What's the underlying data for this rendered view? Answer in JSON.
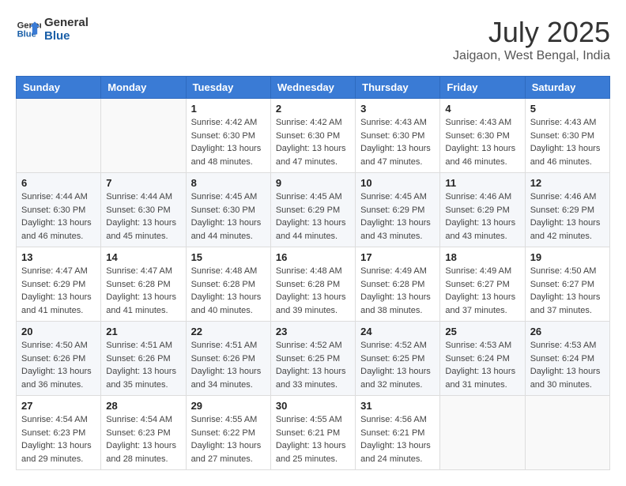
{
  "header": {
    "logo_line1": "General",
    "logo_line2": "Blue",
    "month": "July 2025",
    "location": "Jaigaon, West Bengal, India"
  },
  "weekdays": [
    "Sunday",
    "Monday",
    "Tuesday",
    "Wednesday",
    "Thursday",
    "Friday",
    "Saturday"
  ],
  "weeks": [
    [
      {
        "day": "",
        "sunrise": "",
        "sunset": "",
        "daylight": ""
      },
      {
        "day": "",
        "sunrise": "",
        "sunset": "",
        "daylight": ""
      },
      {
        "day": "1",
        "sunrise": "Sunrise: 4:42 AM",
        "sunset": "Sunset: 6:30 PM",
        "daylight": "Daylight: 13 hours and 48 minutes."
      },
      {
        "day": "2",
        "sunrise": "Sunrise: 4:42 AM",
        "sunset": "Sunset: 6:30 PM",
        "daylight": "Daylight: 13 hours and 47 minutes."
      },
      {
        "day": "3",
        "sunrise": "Sunrise: 4:43 AM",
        "sunset": "Sunset: 6:30 PM",
        "daylight": "Daylight: 13 hours and 47 minutes."
      },
      {
        "day": "4",
        "sunrise": "Sunrise: 4:43 AM",
        "sunset": "Sunset: 6:30 PM",
        "daylight": "Daylight: 13 hours and 46 minutes."
      },
      {
        "day": "5",
        "sunrise": "Sunrise: 4:43 AM",
        "sunset": "Sunset: 6:30 PM",
        "daylight": "Daylight: 13 hours and 46 minutes."
      }
    ],
    [
      {
        "day": "6",
        "sunrise": "Sunrise: 4:44 AM",
        "sunset": "Sunset: 6:30 PM",
        "daylight": "Daylight: 13 hours and 46 minutes."
      },
      {
        "day": "7",
        "sunrise": "Sunrise: 4:44 AM",
        "sunset": "Sunset: 6:30 PM",
        "daylight": "Daylight: 13 hours and 45 minutes."
      },
      {
        "day": "8",
        "sunrise": "Sunrise: 4:45 AM",
        "sunset": "Sunset: 6:30 PM",
        "daylight": "Daylight: 13 hours and 44 minutes."
      },
      {
        "day": "9",
        "sunrise": "Sunrise: 4:45 AM",
        "sunset": "Sunset: 6:29 PM",
        "daylight": "Daylight: 13 hours and 44 minutes."
      },
      {
        "day": "10",
        "sunrise": "Sunrise: 4:45 AM",
        "sunset": "Sunset: 6:29 PM",
        "daylight": "Daylight: 13 hours and 43 minutes."
      },
      {
        "day": "11",
        "sunrise": "Sunrise: 4:46 AM",
        "sunset": "Sunset: 6:29 PM",
        "daylight": "Daylight: 13 hours and 43 minutes."
      },
      {
        "day": "12",
        "sunrise": "Sunrise: 4:46 AM",
        "sunset": "Sunset: 6:29 PM",
        "daylight": "Daylight: 13 hours and 42 minutes."
      }
    ],
    [
      {
        "day": "13",
        "sunrise": "Sunrise: 4:47 AM",
        "sunset": "Sunset: 6:29 PM",
        "daylight": "Daylight: 13 hours and 41 minutes."
      },
      {
        "day": "14",
        "sunrise": "Sunrise: 4:47 AM",
        "sunset": "Sunset: 6:28 PM",
        "daylight": "Daylight: 13 hours and 41 minutes."
      },
      {
        "day": "15",
        "sunrise": "Sunrise: 4:48 AM",
        "sunset": "Sunset: 6:28 PM",
        "daylight": "Daylight: 13 hours and 40 minutes."
      },
      {
        "day": "16",
        "sunrise": "Sunrise: 4:48 AM",
        "sunset": "Sunset: 6:28 PM",
        "daylight": "Daylight: 13 hours and 39 minutes."
      },
      {
        "day": "17",
        "sunrise": "Sunrise: 4:49 AM",
        "sunset": "Sunset: 6:28 PM",
        "daylight": "Daylight: 13 hours and 38 minutes."
      },
      {
        "day": "18",
        "sunrise": "Sunrise: 4:49 AM",
        "sunset": "Sunset: 6:27 PM",
        "daylight": "Daylight: 13 hours and 37 minutes."
      },
      {
        "day": "19",
        "sunrise": "Sunrise: 4:50 AM",
        "sunset": "Sunset: 6:27 PM",
        "daylight": "Daylight: 13 hours and 37 minutes."
      }
    ],
    [
      {
        "day": "20",
        "sunrise": "Sunrise: 4:50 AM",
        "sunset": "Sunset: 6:26 PM",
        "daylight": "Daylight: 13 hours and 36 minutes."
      },
      {
        "day": "21",
        "sunrise": "Sunrise: 4:51 AM",
        "sunset": "Sunset: 6:26 PM",
        "daylight": "Daylight: 13 hours and 35 minutes."
      },
      {
        "day": "22",
        "sunrise": "Sunrise: 4:51 AM",
        "sunset": "Sunset: 6:26 PM",
        "daylight": "Daylight: 13 hours and 34 minutes."
      },
      {
        "day": "23",
        "sunrise": "Sunrise: 4:52 AM",
        "sunset": "Sunset: 6:25 PM",
        "daylight": "Daylight: 13 hours and 33 minutes."
      },
      {
        "day": "24",
        "sunrise": "Sunrise: 4:52 AM",
        "sunset": "Sunset: 6:25 PM",
        "daylight": "Daylight: 13 hours and 32 minutes."
      },
      {
        "day": "25",
        "sunrise": "Sunrise: 4:53 AM",
        "sunset": "Sunset: 6:24 PM",
        "daylight": "Daylight: 13 hours and 31 minutes."
      },
      {
        "day": "26",
        "sunrise": "Sunrise: 4:53 AM",
        "sunset": "Sunset: 6:24 PM",
        "daylight": "Daylight: 13 hours and 30 minutes."
      }
    ],
    [
      {
        "day": "27",
        "sunrise": "Sunrise: 4:54 AM",
        "sunset": "Sunset: 6:23 PM",
        "daylight": "Daylight: 13 hours and 29 minutes."
      },
      {
        "day": "28",
        "sunrise": "Sunrise: 4:54 AM",
        "sunset": "Sunset: 6:23 PM",
        "daylight": "Daylight: 13 hours and 28 minutes."
      },
      {
        "day": "29",
        "sunrise": "Sunrise: 4:55 AM",
        "sunset": "Sunset: 6:22 PM",
        "daylight": "Daylight: 13 hours and 27 minutes."
      },
      {
        "day": "30",
        "sunrise": "Sunrise: 4:55 AM",
        "sunset": "Sunset: 6:21 PM",
        "daylight": "Daylight: 13 hours and 25 minutes."
      },
      {
        "day": "31",
        "sunrise": "Sunrise: 4:56 AM",
        "sunset": "Sunset: 6:21 PM",
        "daylight": "Daylight: 13 hours and 24 minutes."
      },
      {
        "day": "",
        "sunrise": "",
        "sunset": "",
        "daylight": ""
      },
      {
        "day": "",
        "sunrise": "",
        "sunset": "",
        "daylight": ""
      }
    ]
  ]
}
